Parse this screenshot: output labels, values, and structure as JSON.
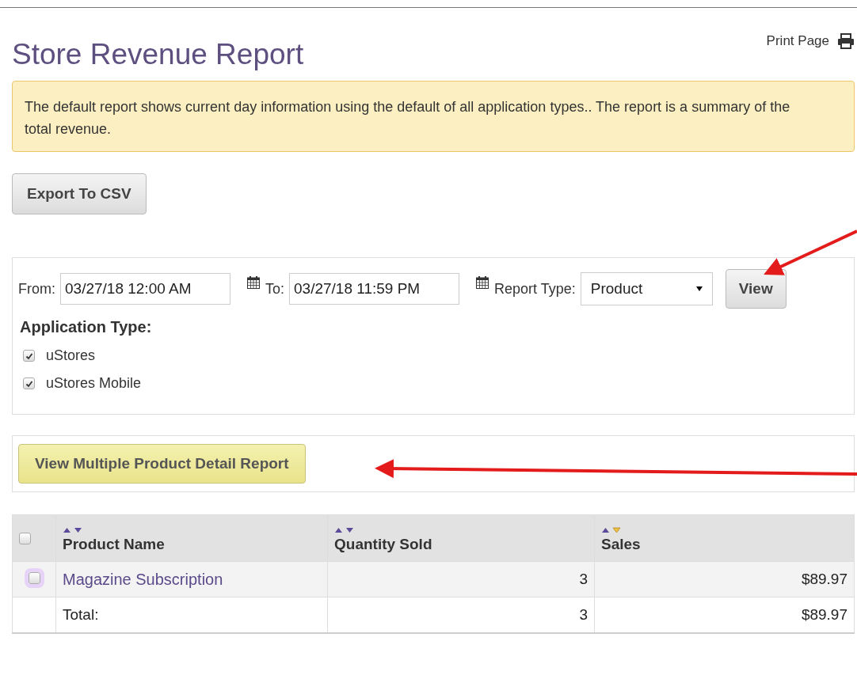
{
  "header": {
    "title": "Store Revenue Report",
    "print_link": "Print Page"
  },
  "notice": "The default report shows current day information using the default of all application types.. The report is a summary of the total revenue.",
  "export_button": "Export To CSV",
  "filters": {
    "from_label": "From:",
    "from_value": "03/27/18 12:00 AM",
    "to_label": "To:",
    "to_value": "03/27/18 11:59 PM",
    "report_type_label": "Report Type:",
    "report_type_value": "Product",
    "view_button": "View",
    "application_type_label": "Application Type:",
    "application_types": [
      {
        "label": "uStores",
        "checked": true
      },
      {
        "label": "uStores Mobile",
        "checked": true
      }
    ]
  },
  "detail_button": "View Multiple Product Detail Report",
  "table": {
    "select_all_checked": false,
    "columns": [
      {
        "label": "Product Name",
        "sorted_descending": false
      },
      {
        "label": "Quantity Sold",
        "sorted_descending": false
      },
      {
        "label": "Sales",
        "sorted_descending": true
      }
    ],
    "rows": [
      {
        "kind": "item",
        "checked": false,
        "cells": [
          "Magazine Subscription",
          "3",
          "$89.97"
        ]
      },
      {
        "kind": "total",
        "cells": [
          "Total:",
          "3",
          "$89.97"
        ]
      }
    ]
  }
}
